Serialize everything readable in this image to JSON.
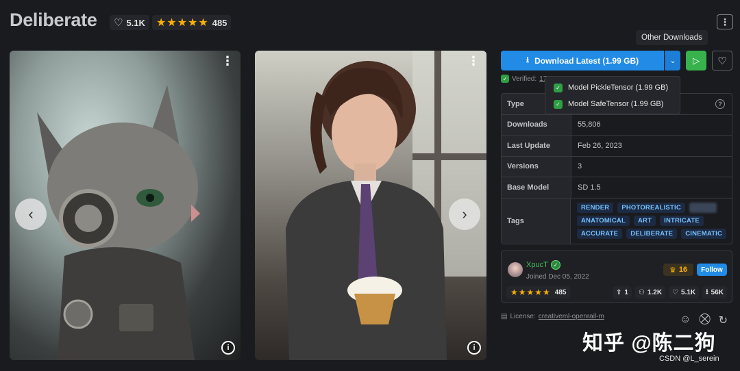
{
  "header": {
    "title": "Deliberate",
    "likes": "5.1K",
    "rating_stars": "★★★★★",
    "rating_count": "485",
    "menu_icon": "kebab-icon",
    "tooltip": "Other Downloads"
  },
  "gallery": {
    "prev_icon": "‹",
    "next_icon": "›",
    "more_icon": "⋮",
    "info_icon": "i"
  },
  "actions": {
    "download_label": "Download Latest (1.99 GB)",
    "caret": "⌄",
    "play": "▷",
    "heart": "♡"
  },
  "verified": {
    "label": "Verified:",
    "link": "17"
  },
  "downloads_menu": [
    {
      "label": "Model PickleTensor (1.99 GB)"
    },
    {
      "label": "Model SafeTensor (1.99 GB)"
    }
  ],
  "details": {
    "type_key": "Type",
    "downloads_key": "Downloads",
    "downloads_val": "55,806",
    "update_key": "Last Update",
    "update_val": "Feb 26, 2023",
    "versions_key": "Versions",
    "versions_val": "3",
    "base_key": "Base Model",
    "base_val": "SD 1.5",
    "tags_key": "Tags",
    "tags": [
      "RENDER",
      "PHOTOREALISTIC",
      "",
      "ANATOMICAL",
      "ART",
      "INTRICATE",
      "ACCURATE",
      "DELIBERATE",
      "CINEMATIC"
    ]
  },
  "creator": {
    "name": "XpucT",
    "joined": "Joined Dec 05, 2022",
    "rank": "16",
    "follow": "Follow",
    "rating_stars": "★★★★★",
    "rating_count": "485",
    "uploads": "1",
    "followers": "1.2K",
    "likes": "5.1K",
    "downloads": "56K"
  },
  "license": {
    "label": "License:",
    "link": "creativeml-openrail-m"
  },
  "watermark": {
    "big": "知乎 @陈二狗",
    "small": "CSDN @L_serein"
  },
  "colors": {
    "background": "#1a1b1e",
    "download_blue": "#228be6",
    "play_green": "#37b24d",
    "star_gold": "#fab005",
    "tag_text": "#74c0fc"
  }
}
